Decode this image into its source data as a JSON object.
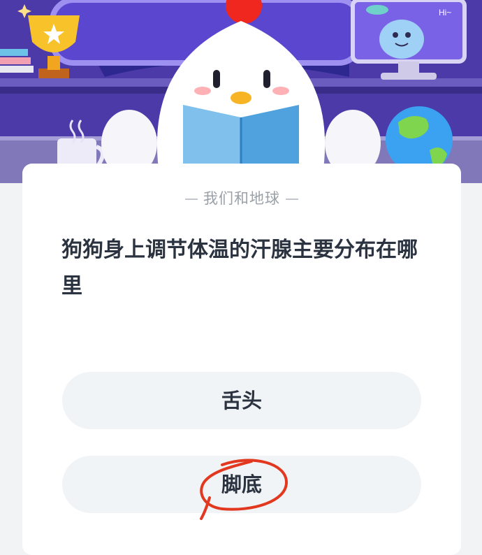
{
  "category": "我们和地球",
  "question": "狗狗身上调节体温的汗腺主要分布在哪里",
  "options": [
    {
      "label": "舌头"
    },
    {
      "label": "脚底"
    }
  ],
  "monitor_text": "Hi~",
  "colors": {
    "hero_purple": "#5b3fd6",
    "card_bg": "#ffffff",
    "option_bg": "#f1f4f6",
    "text_dark": "#2b3340",
    "annotation_red": "#e2381f"
  }
}
